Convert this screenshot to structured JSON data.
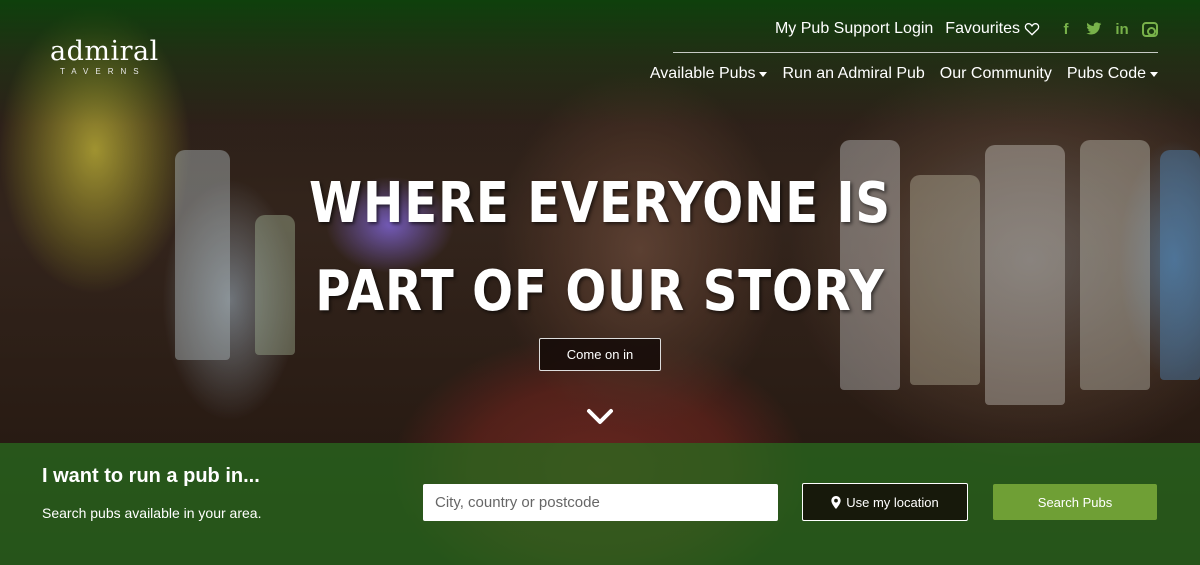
{
  "brand": {
    "name": "admiral",
    "tagline": "TAVERNS"
  },
  "topbar": {
    "support_login": "My Pub Support Login",
    "favourites": "Favourites",
    "social_icons": [
      "facebook-icon",
      "twitter-icon",
      "linkedin-icon",
      "instagram-icon"
    ],
    "social_glyphs": {
      "facebook": "f",
      "twitter": "t",
      "linkedin": "in"
    }
  },
  "nav": {
    "items": [
      {
        "label": "Available Pubs",
        "dropdown": true
      },
      {
        "label": "Run an Admiral Pub",
        "dropdown": false
      },
      {
        "label": "Our Community",
        "dropdown": false
      },
      {
        "label": "Pubs Code",
        "dropdown": true
      }
    ]
  },
  "hero": {
    "headline_line1": "WHERE EVERYONE IS",
    "headline_line2": "PART OF OUR STORY",
    "cta_label": "Come on in"
  },
  "search": {
    "title": "I want to run a pub in...",
    "subtitle": "Search pubs available in your area.",
    "placeholder": "City, country or postcode",
    "value": "",
    "location_label": "Use my location",
    "submit_label": "Search Pubs"
  },
  "colors": {
    "brand_green": "#6f9f35",
    "social_green": "#78b24a",
    "band_green": "#286e1e"
  }
}
